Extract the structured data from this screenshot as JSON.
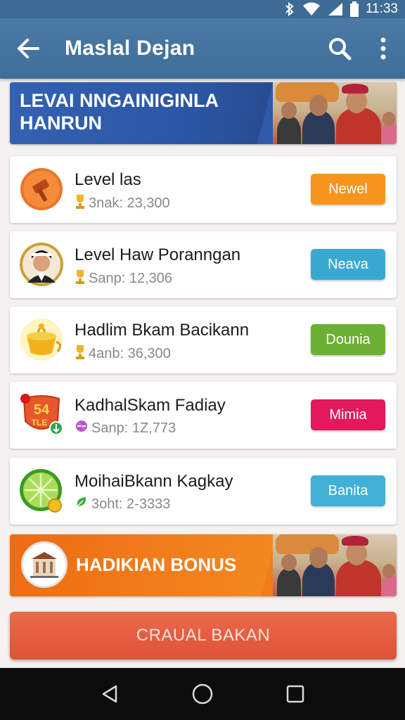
{
  "status_bar": {
    "time": "11:33",
    "icons": [
      "bluetooth-icon",
      "wifi-icon",
      "signal-icon",
      "battery-icon"
    ]
  },
  "app_bar": {
    "title": "Maslal Dejan",
    "icons": [
      "back-arrow-icon",
      "search-icon",
      "more-vert-icon"
    ]
  },
  "top_banner": {
    "text": "LEVAI NNGAINIGINLA HANRUN"
  },
  "items": [
    {
      "name": "Level las",
      "sub": "3nak: 23,300",
      "sub_icon": "trophy-icon",
      "icon": "hammer-badge-icon",
      "button": "Newel",
      "button_color": "#f7941d"
    },
    {
      "name": "Level Haw Poranngan",
      "sub": "Sanp: 12,306",
      "sub_icon": "trophy-icon",
      "icon": "character-avatar-icon",
      "button": "Neava",
      "button_color": "#3aa9d2"
    },
    {
      "name": "Hadlim Bkam Bacikann",
      "sub": "4anb: 36,300",
      "sub_icon": "trophy-icon",
      "icon": "golden-pot-icon",
      "button": "Dounia",
      "button_color": "#6cb033"
    },
    {
      "name": "KadhalSkam Fadiay",
      "sub": "Sanp: 1Z,773",
      "sub_icon": "gem-icon",
      "icon": "level-shield-icon",
      "button": "Mimia",
      "button_color": "#e3195e"
    },
    {
      "name": "MoihaiBkann Kagkay",
      "sub": "3oht:  2-3333",
      "sub_icon": "leaf-icon",
      "icon": "lime-icon",
      "button": "Banita",
      "button_color": "#41b0d6"
    }
  ],
  "shield_text": "54",
  "shield_sub": "TLE",
  "bottom_banner": {
    "text": "HADIKIAN BONUS"
  },
  "cta": {
    "label": "CRAUAL BAKAN"
  },
  "nav_bar": {
    "icons": [
      "back-triangle-icon",
      "home-circle-icon",
      "recents-square-icon"
    ]
  }
}
